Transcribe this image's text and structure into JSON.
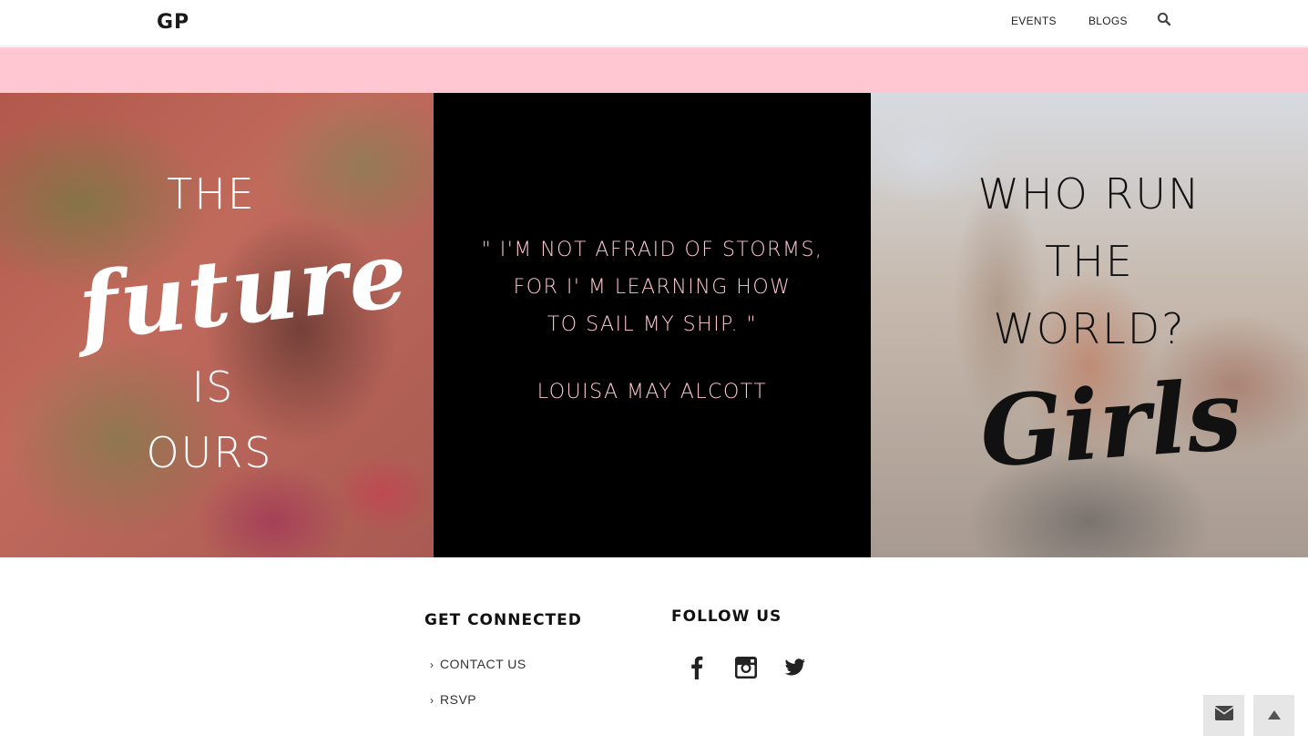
{
  "header": {
    "logo": "GP",
    "nav": [
      {
        "label": "EVENTS"
      },
      {
        "label": "BLOGS"
      }
    ]
  },
  "panels": {
    "left": {
      "line1": "THE",
      "script": "future",
      "line2": "IS",
      "line3": "OURS"
    },
    "middle": {
      "quote_line1": "\" I'M NOT AFRAID OF STORMS,",
      "quote_line2": "FOR I' M LEARNING HOW",
      "quote_line3": "TO SAIL MY SHIP. \"",
      "author": "LOUISA MAY ALCOTT"
    },
    "right": {
      "line1": "WHO RUN",
      "line2": "THE",
      "line3": "WORLD?",
      "script": "Girls"
    }
  },
  "footer": {
    "get_connected": {
      "heading": "GET CONNECTED",
      "links": [
        {
          "label": "CONTACT US"
        },
        {
          "label": "RSVP"
        }
      ]
    },
    "follow_us": {
      "heading": "FOLLOW US",
      "icons": [
        "facebook-icon",
        "instagram-icon",
        "twitter-icon"
      ]
    }
  },
  "colors": {
    "pink": "#ffc7d2",
    "black": "#000000",
    "button_gray": "#e6e6e6"
  }
}
